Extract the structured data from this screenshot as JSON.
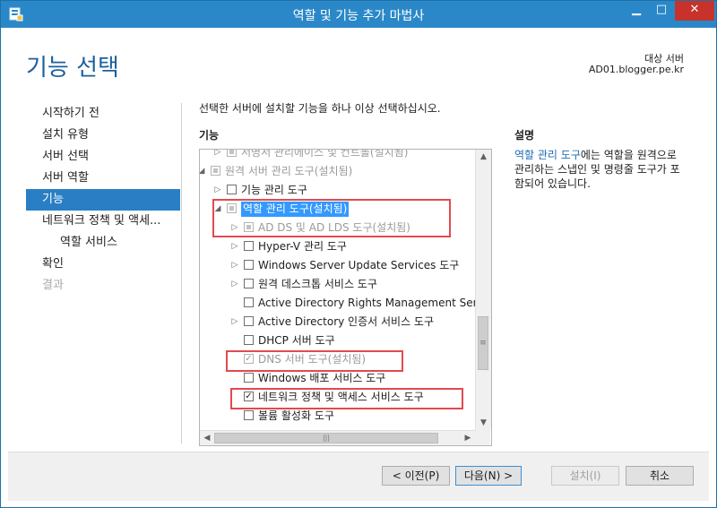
{
  "window": {
    "title": "역할 및 기능 추가 마법사",
    "icon": "server-manager-icon"
  },
  "page": {
    "title": "기능 선택",
    "dest_label": "대상 서버",
    "dest_server": "AD01.blogger.pe.kr"
  },
  "nav": [
    {
      "label": "시작하기 전",
      "state": "normal"
    },
    {
      "label": "설치 유형",
      "state": "normal"
    },
    {
      "label": "서버 선택",
      "state": "normal"
    },
    {
      "label": "서버 역할",
      "state": "normal"
    },
    {
      "label": "기능",
      "state": "active"
    },
    {
      "label": "네트워크 정책 및 액세...",
      "state": "normal"
    },
    {
      "label": "역할 서비스",
      "state": "sub"
    },
    {
      "label": "확인",
      "state": "normal"
    },
    {
      "label": "결과",
      "state": "disabled"
    }
  ],
  "main": {
    "instruction": "선택한 서버에 설치할 기능을 하나 이상 선택하십시오.",
    "features_label": "기능",
    "description_label": "설명",
    "description_link": "역할 관리 도구",
    "description_text": "에는 역할을 원격으로 관리하는 스냅인 및 명령줄 도구가 포함되어 있습니다."
  },
  "features": [
    {
      "label": "서명서 관리에이스 및 컨트롤(설치됨)",
      "level": 1,
      "expander": "collapsed",
      "check": "partial",
      "disabled": true
    },
    {
      "label": "원격 서버 관리 도구(설치됨)",
      "level": 0,
      "expander": "expanded",
      "check": "partial",
      "disabled": true
    },
    {
      "label": "기능 관리 도구",
      "level": 1,
      "expander": "collapsed",
      "check": "unchecked",
      "disabled": false
    },
    {
      "label": "역할 관리 도구(설치됨)",
      "level": 1,
      "expander": "expanded",
      "check": "partial",
      "disabled": true,
      "selected": true
    },
    {
      "label": "AD DS 및 AD LDS 도구(설치됨)",
      "level": 2,
      "expander": "collapsed",
      "check": "partial",
      "disabled": true
    },
    {
      "label": "Hyper-V 관리 도구",
      "level": 2,
      "expander": "collapsed",
      "check": "unchecked",
      "disabled": false
    },
    {
      "label": "Windows Server Update Services 도구",
      "level": 2,
      "expander": "collapsed",
      "check": "unchecked",
      "disabled": false
    },
    {
      "label": "원격 데스크톱 서비스 도구",
      "level": 2,
      "expander": "collapsed",
      "check": "unchecked",
      "disabled": false
    },
    {
      "label": "Active Directory Rights Management Services 도구",
      "level": 2,
      "expander": "none",
      "check": "unchecked",
      "disabled": false
    },
    {
      "label": "Active Directory 인증서 서비스 도구",
      "level": 2,
      "expander": "collapsed",
      "check": "unchecked",
      "disabled": false
    },
    {
      "label": "DHCP 서버 도구",
      "level": 2,
      "expander": "none",
      "check": "unchecked",
      "disabled": false
    },
    {
      "label": "DNS 서버 도구(설치됨)",
      "level": 2,
      "expander": "none",
      "check": "checked",
      "disabled": true
    },
    {
      "label": "Windows 배포 서비스 도구",
      "level": 2,
      "expander": "none",
      "check": "unchecked",
      "disabled": false
    },
    {
      "label": "네트워크 정책 및 액세스 서비스 도구",
      "level": 2,
      "expander": "none",
      "check": "checked",
      "disabled": false
    },
    {
      "label": "볼륨 활성화 도구",
      "level": 2,
      "expander": "none",
      "check": "unchecked",
      "disabled": false
    }
  ],
  "buttons": {
    "prev": "< 이전(P)",
    "next": "다음(N) >",
    "install": "설치(I)",
    "cancel": "취소"
  },
  "colors": {
    "accent": "#2a7fc4",
    "titlebar": "#2a88c8",
    "highlight": "#e24a4f",
    "selection": "#3399ff"
  }
}
